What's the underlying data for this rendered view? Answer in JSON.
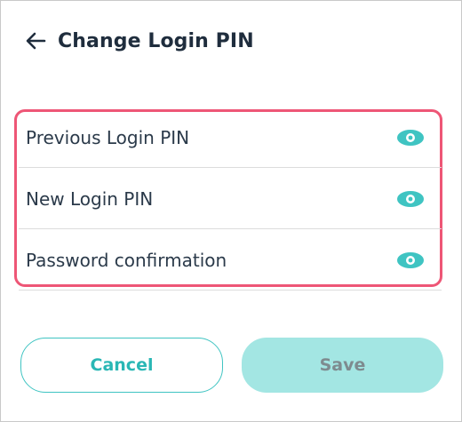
{
  "header": {
    "back_icon": "arrow-left-icon",
    "title": "Change Login PIN"
  },
  "form": {
    "fields": [
      {
        "label": "Previous Login PIN",
        "icon": "eye-icon"
      },
      {
        "label": "New Login PIN",
        "icon": "eye-icon"
      },
      {
        "label": "Password confirmation",
        "icon": "eye-icon"
      }
    ],
    "highlight_color": "#ee5676"
  },
  "actions": {
    "cancel_label": "Cancel",
    "save_label": "Save"
  },
  "colors": {
    "accent": "#3fc4c2",
    "save_disabled_bg": "#a3e6e3",
    "text": "#1f2d3d"
  }
}
